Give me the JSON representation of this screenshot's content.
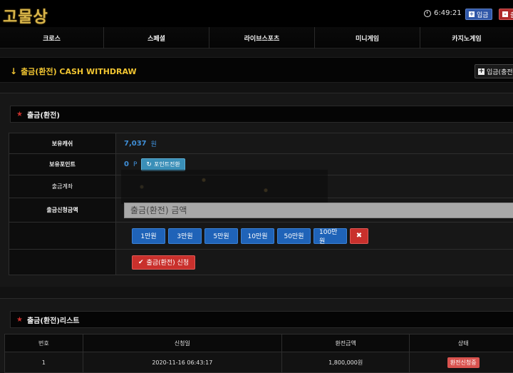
{
  "header": {
    "logo_text": "고물상",
    "time": "6:49:21",
    "deposit_label": "입금",
    "withdraw_label": "출"
  },
  "nav": {
    "items": [
      "크로스",
      "스페셜",
      "라이브스포츠",
      "미니게임",
      "카지노게임"
    ]
  },
  "page": {
    "title": "출금(환전) CASH WITHDRAW",
    "deposit_button": "입금(충전"
  },
  "form_section": {
    "title": "출금(환전)",
    "rows": {
      "balance_label": "보유캐쉬",
      "balance_value": "7,037",
      "balance_unit": "원",
      "points_label": "보유포인트",
      "points_value": "0",
      "points_unit": "P",
      "convert_button": "포인트전환",
      "account_label": "출금계좌",
      "amount_label": "출금신청금액",
      "amount_placeholder": "출금(환전) 금액"
    },
    "amount_buttons": [
      "1만원",
      "3만원",
      "5만원",
      "10만원",
      "50만원",
      "100만원"
    ],
    "apply_button": "출금(환전) 신청"
  },
  "list_section": {
    "title": "출금(환전)리스트",
    "columns": [
      "번호",
      "신청일",
      "환전금액",
      "상태"
    ],
    "rows": [
      {
        "no": "1",
        "date": "2020-11-16 06:43:17",
        "amount": "1,800,000원",
        "status": "환전신청중"
      }
    ]
  },
  "colors": {
    "accent_gold": "#f0c431",
    "primary_blue": "#1f63b8",
    "danger_red": "#c9302c",
    "money_blue": "#3f8fd8"
  }
}
